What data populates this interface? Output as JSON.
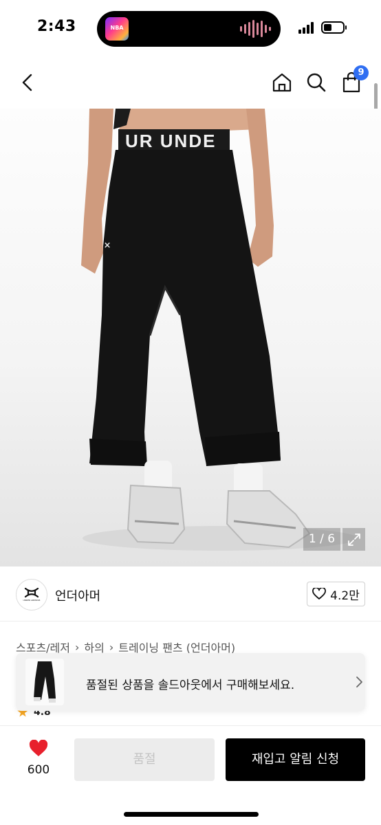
{
  "status_bar": {
    "time": "2:43",
    "now_playing_art": "NBA"
  },
  "nav": {
    "cart_count": "9",
    "back_icon": "chevron-left-icon",
    "home_icon": "home-icon",
    "search_icon": "search-icon",
    "cart_icon": "shopping-bag-icon"
  },
  "product_image": {
    "counter": "1 / 6",
    "waistband_text": "UR UNDE"
  },
  "brand": {
    "name": "언더아머",
    "likes": "4.2만",
    "logo_text": "UNDER ARMOUR"
  },
  "breadcrumb": [
    "스포츠/레저",
    "하의",
    "트레이닝 팬츠 (언더아머)"
  ],
  "rating": {
    "score": "4.8"
  },
  "soldout_banner": {
    "text": "품절된 상품을 솔드아웃에서 구매해보세요."
  },
  "bottom_bar": {
    "like_count": "600",
    "soldout_label": "품절",
    "restock_label": "재입고 알림 신청"
  },
  "colors": {
    "accent_badge": "#2f6ef2",
    "heart": "#e8202c",
    "primary_button": "#000000",
    "disabled_button": "#ececec"
  }
}
